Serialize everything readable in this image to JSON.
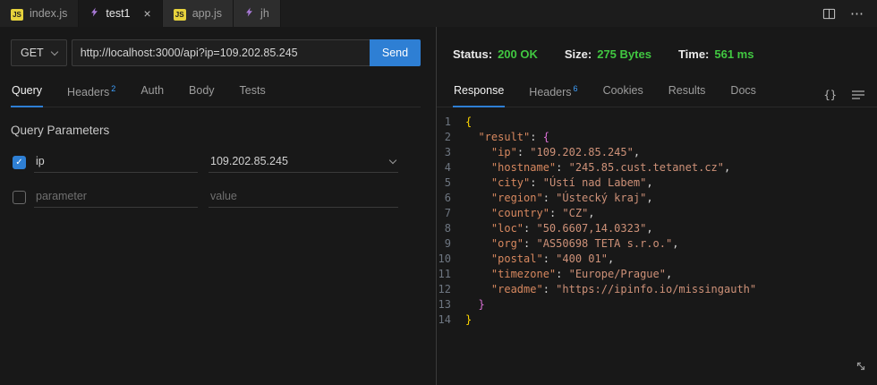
{
  "window": {
    "editor_tabs": [
      {
        "label": "index.js",
        "icon": "js-file-icon",
        "type": "js",
        "active": false
      },
      {
        "label": "test1",
        "icon": "thunder-client-icon",
        "type": "tc",
        "active": true
      },
      {
        "label": "app.js",
        "icon": "js-file-icon",
        "type": "js",
        "active": false
      },
      {
        "label": "jh",
        "icon": "thunder-client-icon",
        "type": "tc",
        "active": false
      }
    ],
    "close_glyph": "×",
    "more_icon": "⋯"
  },
  "request": {
    "method": "GET",
    "url": "http://localhost:3000/api?ip=109.202.85.245",
    "send_label": "Send",
    "tabs": [
      {
        "label": "Query",
        "active": true
      },
      {
        "label": "Headers",
        "badge": "2",
        "active": false
      },
      {
        "label": "Auth",
        "active": false
      },
      {
        "label": "Body",
        "active": false
      },
      {
        "label": "Tests",
        "active": false
      }
    ]
  },
  "query_section": {
    "title": "Query Parameters",
    "rows": [
      {
        "checked": true,
        "name": "ip",
        "value": "109.202.85.245",
        "dropdown": true
      },
      {
        "checked": false,
        "name": "",
        "name_placeholder": "parameter",
        "value": "",
        "value_placeholder": "value",
        "dropdown": false
      }
    ]
  },
  "response": {
    "meta": {
      "status_label": "Status:",
      "status_value": "200 OK",
      "size_label": "Size:",
      "size_value": "275 Bytes",
      "time_label": "Time:",
      "time_value": "561 ms"
    },
    "tabs": [
      {
        "label": "Response",
        "active": true
      },
      {
        "label": "Headers",
        "badge": "6",
        "active": false
      },
      {
        "label": "Cookies",
        "active": false
      },
      {
        "label": "Results",
        "active": false
      },
      {
        "label": "Docs",
        "active": false
      }
    ],
    "format_icon": "{}",
    "code_lines": [
      {
        "n": 1,
        "ind": 0,
        "parts": [
          [
            "b1",
            "{"
          ]
        ]
      },
      {
        "n": 2,
        "ind": 2,
        "parts": [
          [
            "k",
            "\"result\""
          ],
          [
            "p",
            ": "
          ],
          [
            "b2",
            "{"
          ]
        ]
      },
      {
        "n": 3,
        "ind": 4,
        "parts": [
          [
            "k",
            "\"ip\""
          ],
          [
            "p",
            ": "
          ],
          [
            "s",
            "\"109.202.85.245\""
          ],
          [
            "p",
            ","
          ]
        ]
      },
      {
        "n": 4,
        "ind": 4,
        "parts": [
          [
            "k",
            "\"hostname\""
          ],
          [
            "p",
            ": "
          ],
          [
            "s",
            "\"245.85.cust.tetanet.cz\""
          ],
          [
            "p",
            ","
          ]
        ]
      },
      {
        "n": 5,
        "ind": 4,
        "parts": [
          [
            "k",
            "\"city\""
          ],
          [
            "p",
            ": "
          ],
          [
            "s",
            "\"Ústí nad Labem\""
          ],
          [
            "p",
            ","
          ]
        ]
      },
      {
        "n": 6,
        "ind": 4,
        "parts": [
          [
            "k",
            "\"region\""
          ],
          [
            "p",
            ": "
          ],
          [
            "s",
            "\"Ústecký kraj\""
          ],
          [
            "p",
            ","
          ]
        ]
      },
      {
        "n": 7,
        "ind": 4,
        "parts": [
          [
            "k",
            "\"country\""
          ],
          [
            "p",
            ": "
          ],
          [
            "s",
            "\"CZ\""
          ],
          [
            "p",
            ","
          ]
        ]
      },
      {
        "n": 8,
        "ind": 4,
        "parts": [
          [
            "k",
            "\"loc\""
          ],
          [
            "p",
            ": "
          ],
          [
            "s",
            "\"50.6607,14.0323\""
          ],
          [
            "p",
            ","
          ]
        ]
      },
      {
        "n": 9,
        "ind": 4,
        "parts": [
          [
            "k",
            "\"org\""
          ],
          [
            "p",
            ": "
          ],
          [
            "s",
            "\"AS50698 TETA s.r.o.\""
          ],
          [
            "p",
            ","
          ]
        ]
      },
      {
        "n": 10,
        "ind": 4,
        "parts": [
          [
            "k",
            "\"postal\""
          ],
          [
            "p",
            ": "
          ],
          [
            "s",
            "\"400 01\""
          ],
          [
            "p",
            ","
          ]
        ]
      },
      {
        "n": 11,
        "ind": 4,
        "parts": [
          [
            "k",
            "\"timezone\""
          ],
          [
            "p",
            ": "
          ],
          [
            "s",
            "\"Europe/Prague\""
          ],
          [
            "p",
            ","
          ]
        ]
      },
      {
        "n": 12,
        "ind": 4,
        "parts": [
          [
            "k",
            "\"readme\""
          ],
          [
            "p",
            ": "
          ],
          [
            "s",
            "\"https://ipinfo.io/missingauth\""
          ]
        ]
      },
      {
        "n": 13,
        "ind": 2,
        "parts": [
          [
            "b2",
            "}"
          ]
        ]
      },
      {
        "n": 14,
        "ind": 0,
        "parts": [
          [
            "b1",
            "}"
          ]
        ]
      }
    ]
  },
  "colors": {
    "accent_blue": "#2e7fd4",
    "success_green": "#41c741",
    "key_orange": "#d7885f",
    "string_orange": "#ce9178"
  }
}
